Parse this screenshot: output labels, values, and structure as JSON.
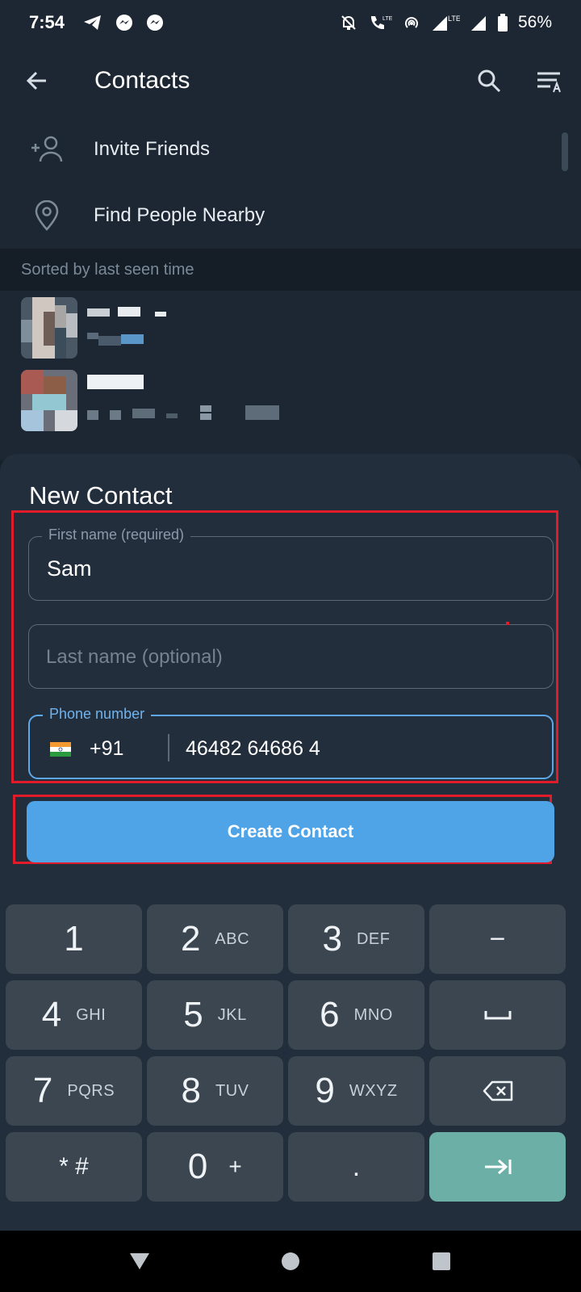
{
  "status_bar": {
    "time": "7:54",
    "battery": "56%",
    "lte_label": "LTE"
  },
  "app_bar": {
    "title": "Contacts"
  },
  "menu": {
    "items": [
      {
        "label": "Invite Friends",
        "icon": "add-person-icon"
      },
      {
        "label": "Find People Nearby",
        "icon": "location-pin-icon"
      }
    ]
  },
  "section_header": "Sorted by last seen time",
  "sheet": {
    "title": "New Contact",
    "first_name": {
      "label": "First name (required)",
      "value": "Sam"
    },
    "last_name": {
      "placeholder": "Last name (optional)"
    },
    "phone": {
      "label": "Phone number",
      "country_code": "+91",
      "number": "46482 64686 4"
    },
    "create_button": "Create Contact"
  },
  "keypad": {
    "keys": [
      {
        "digit": "1",
        "letters": ""
      },
      {
        "digit": "2",
        "letters": "ABC"
      },
      {
        "digit": "3",
        "letters": "DEF"
      },
      {
        "digit": "4",
        "letters": "GHI"
      },
      {
        "digit": "5",
        "letters": "JKL"
      },
      {
        "digit": "6",
        "letters": "MNO"
      },
      {
        "digit": "7",
        "letters": "PQRS"
      },
      {
        "digit": "8",
        "letters": "TUV"
      },
      {
        "digit": "9",
        "letters": "WXYZ"
      },
      {
        "digit": "0",
        "letters": "+"
      }
    ],
    "star_hash": "* #",
    "minus": "−",
    "dot": "."
  },
  "colors": {
    "background": "#17212b",
    "accent": "#4fa4e8",
    "highlight": "#e11b2a",
    "next_key": "#6cafa6"
  }
}
